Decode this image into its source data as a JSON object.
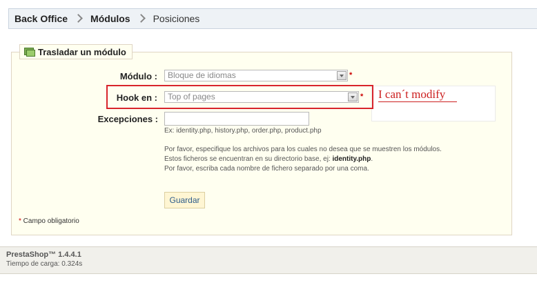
{
  "breadcrumb": {
    "items": [
      "Back Office",
      "Módulos",
      "Posiciones"
    ]
  },
  "form": {
    "legend": "Trasladar un módulo",
    "module": {
      "label": "Módulo :",
      "value": "Bloque de idiomas",
      "required": "*"
    },
    "hook": {
      "label": "Hook en :",
      "value": "Top of pages",
      "required": "*"
    },
    "exceptions": {
      "label": "Excepciones :",
      "value": "",
      "example": "Ex: identity.php, history.php, order.php, product.php",
      "help_line1": "Por favor, especifique los archivos para los cuales no desea que se muestren los módulos.",
      "help_line2_prefix": "Estos ficheros se encuentran en su directorio base, ej: ",
      "help_line2_bold": "identity.php",
      "help_line2_suffix": ".",
      "help_line3": "Por favor, escriba cada nombre de fichero separado por una coma."
    },
    "submit_label": "Guardar",
    "required_note_star": "*",
    "required_note": " Campo obligatorio"
  },
  "annotation": {
    "text": "I can´t modify",
    "color": "#cc1f1f"
  },
  "footer": {
    "brand": "PrestaShop™ 1.4.4.1",
    "load_time": "Tiempo de carga: 0.324s"
  },
  "colors": {
    "accent_red": "#d8242b",
    "link_blue": "#2b5b8a",
    "panel_bg": "#fffff0"
  },
  "icons": {
    "legend_icon": "stacked-green-folders-icon",
    "breadcrumb_separator": "chevron-right-icon",
    "select_arrow": "chevron-down-icon"
  }
}
